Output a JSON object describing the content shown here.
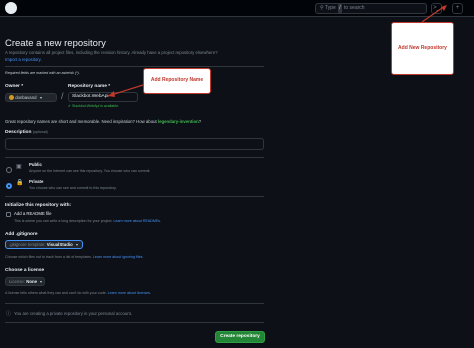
{
  "topbar": {
    "search_prefix": "Type",
    "search_key": "/",
    "search_suffix": "to search",
    "cmd_icon": ">_",
    "plus_icon": "+"
  },
  "page": {
    "title": "Create a new repository",
    "subtitle": "A repository contains all project files, including the revision history. Already have a project repository elsewhere?",
    "import_link": "Import a repository.",
    "required_note": "Required fields are marked with an asterisk (*)."
  },
  "owner": {
    "label": "Owner *",
    "value": "donbavand"
  },
  "repo_name": {
    "label": "Repository name *",
    "value": "Slackbot.WebApi",
    "availability": "Slackbot.WebApi is available."
  },
  "suggestion": {
    "text": "Great repository names are short and memorable. Need inspiration? How about",
    "name": "legendary-invention",
    "end": "?"
  },
  "description": {
    "label": "Description",
    "optional": "(optional)"
  },
  "visibility": {
    "public_label": "Public",
    "public_desc": "Anyone on the internet can see this repository. You choose who can commit.",
    "private_label": "Private",
    "private_desc": "You choose who can see and commit to this repository.",
    "selected": "Private"
  },
  "init": {
    "heading": "Initialize this repository with:",
    "readme_label": "Add a README file",
    "readme_desc": "This is where you can write a long description for your project.",
    "readme_link": "Learn more about READMEs."
  },
  "gitignore": {
    "heading": "Add .gitignore",
    "select_prefix": ".gitignore template:",
    "select_value": "VisualStudio",
    "desc": "Choose which files not to track from a list of templates.",
    "link": "Learn more about ignoring files."
  },
  "license": {
    "heading": "Choose a license",
    "select_prefix": "License:",
    "select_value": "None",
    "desc": "A license tells others what they can and can't do with your code.",
    "link": "Learn more about licenses."
  },
  "private_note": "You are creating a private repository in your personal account.",
  "create_button": "Create repository",
  "annotations": {
    "repo_name_callout": "Add Repository Name",
    "new_repo_callout": "Add New Repository",
    "color": "#c0392b"
  }
}
